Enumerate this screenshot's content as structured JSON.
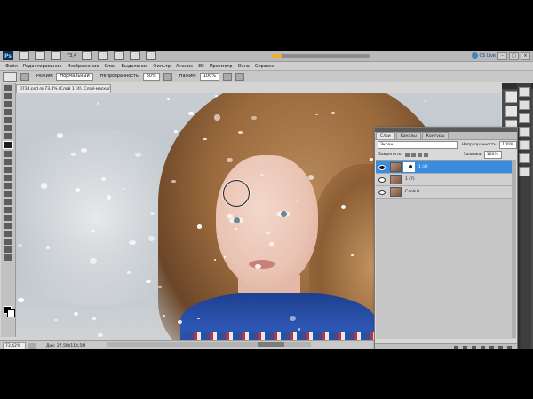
{
  "app": {
    "logo": "Ps",
    "zoom_display": "73,4",
    "cs_live": "CS Live",
    "progress_fraction": 0.1,
    "window_buttons": [
      "–",
      "□",
      "×"
    ]
  },
  "menu": [
    "Файл",
    "Редактирование",
    "Изображение",
    "Слои",
    "Выделение",
    "Фильтр",
    "Анализ",
    "3D",
    "Просмотр",
    "Окно",
    "Справка"
  ],
  "options": {
    "mode_label": "Режим:",
    "mode_value": "Нормальный",
    "opacity_label": "Непрозрачность:",
    "opacity_value": "80%",
    "pressure_label": "Нажим:",
    "pressure_value": "100%"
  },
  "document": {
    "tab_title": "0733.psd @ 73,4% (Слой 1 (4), Слой-маска/8) *"
  },
  "status": {
    "zoom": "73,42%",
    "doc_info": "Док: 27,5M/114,5M"
  },
  "layers_panel": {
    "tabs": [
      "Слои",
      "Каналы",
      "Контуры"
    ],
    "blend_mode": "Экран",
    "opacity_label": "Непрозрачность:",
    "opacity_value": "100%",
    "lock_label": "Закрепить:",
    "fill_label": "Заливка:",
    "fill_value": "100%",
    "layers": [
      {
        "name": "1 (4)",
        "selected": true,
        "has_mask": true
      },
      {
        "name": "1 (7)",
        "selected": false,
        "has_mask": false
      },
      {
        "name": "Слой 0",
        "selected": false,
        "has_mask": false
      }
    ]
  },
  "colors": {
    "selection_blue": "#3a8ce0",
    "progress": "#f1b12a"
  }
}
